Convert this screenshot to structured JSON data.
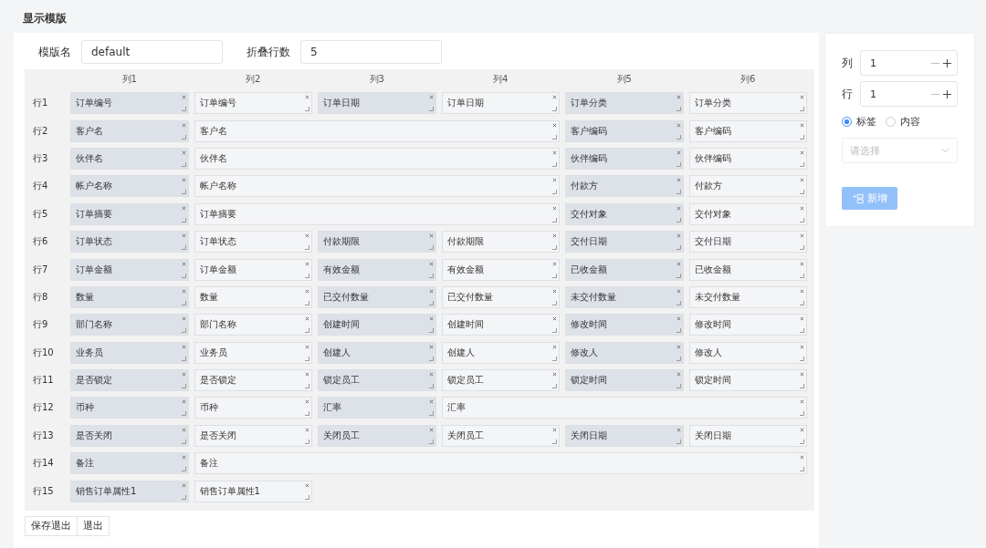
{
  "title": "显示模版",
  "form": {
    "template_name_label": "模版名",
    "template_name": "default",
    "fold_rows_label": "折叠行数",
    "fold_rows": "5"
  },
  "columns": [
    "列1",
    "列2",
    "列3",
    "列4",
    "列5",
    "列6"
  ],
  "rows": [
    {
      "label": "行1",
      "cells": [
        {
          "text": "订单编号",
          "kind": "label"
        },
        {
          "text": "订单编号",
          "kind": "content"
        },
        {
          "text": "订单日期",
          "kind": "label"
        },
        {
          "text": "订单日期",
          "kind": "content"
        },
        {
          "text": "订单分类",
          "kind": "label"
        },
        {
          "text": "订单分类",
          "kind": "content"
        }
      ]
    },
    {
      "label": "行2",
      "cells": [
        {
          "text": "客户名",
          "kind": "label"
        },
        {
          "text": "客户名",
          "kind": "content"
        },
        {
          "text": "客户编码",
          "kind": "label"
        },
        {
          "text": "客户编码",
          "kind": "content"
        }
      ]
    },
    {
      "label": "行3",
      "cells": [
        {
          "text": "伙伴名",
          "kind": "label"
        },
        {
          "text": "伙伴名",
          "kind": "content"
        },
        {
          "text": "伙伴编码",
          "kind": "label"
        },
        {
          "text": "伙伴编码",
          "kind": "content"
        }
      ]
    },
    {
      "label": "行4",
      "cells": [
        {
          "text": "帐户名称",
          "kind": "label"
        },
        {
          "text": "帐户名称",
          "kind": "content"
        },
        {
          "text": "付款方",
          "kind": "label"
        },
        {
          "text": "付款方",
          "kind": "content"
        }
      ]
    },
    {
      "label": "行5",
      "cells": [
        {
          "text": "订单摘要",
          "kind": "label"
        },
        {
          "text": "订单摘要",
          "kind": "content"
        },
        {
          "text": "交付对象",
          "kind": "label"
        },
        {
          "text": "交付对象",
          "kind": "content"
        }
      ]
    },
    {
      "label": "行6",
      "cells": [
        {
          "text": "订单状态",
          "kind": "label"
        },
        {
          "text": "订单状态",
          "kind": "content"
        },
        {
          "text": "付款期限",
          "kind": "label"
        },
        {
          "text": "付款期限",
          "kind": "content"
        },
        {
          "text": "交付日期",
          "kind": "label"
        },
        {
          "text": "交付日期",
          "kind": "content"
        }
      ]
    },
    {
      "label": "行7",
      "cells": [
        {
          "text": "订单金额",
          "kind": "label"
        },
        {
          "text": "订单金额",
          "kind": "content"
        },
        {
          "text": "有效金额",
          "kind": "label"
        },
        {
          "text": "有效金额",
          "kind": "content"
        },
        {
          "text": "已收金额",
          "kind": "label"
        },
        {
          "text": "已收金额",
          "kind": "content"
        }
      ]
    },
    {
      "label": "行8",
      "cells": [
        {
          "text": "数量",
          "kind": "label"
        },
        {
          "text": "数量",
          "kind": "content"
        },
        {
          "text": "已交付数量",
          "kind": "label"
        },
        {
          "text": "已交付数量",
          "kind": "content"
        },
        {
          "text": "未交付数量",
          "kind": "label"
        },
        {
          "text": "未交付数量",
          "kind": "content"
        }
      ]
    },
    {
      "label": "行9",
      "cells": [
        {
          "text": "部门名称",
          "kind": "label"
        },
        {
          "text": "部门名称",
          "kind": "content"
        },
        {
          "text": "创建时间",
          "kind": "label"
        },
        {
          "text": "创建时间",
          "kind": "content"
        },
        {
          "text": "修改时间",
          "kind": "label"
        },
        {
          "text": "修改时间",
          "kind": "content"
        }
      ]
    },
    {
      "label": "行10",
      "cells": [
        {
          "text": "业务员",
          "kind": "label"
        },
        {
          "text": "业务员",
          "kind": "content"
        },
        {
          "text": "创建人",
          "kind": "label"
        },
        {
          "text": "创建人",
          "kind": "content"
        },
        {
          "text": "修改人",
          "kind": "label"
        },
        {
          "text": "修改人",
          "kind": "content"
        }
      ]
    },
    {
      "label": "行11",
      "cells": [
        {
          "text": "是否锁定",
          "kind": "label"
        },
        {
          "text": "是否锁定",
          "kind": "content"
        },
        {
          "text": "锁定员工",
          "kind": "label"
        },
        {
          "text": "锁定员工",
          "kind": "content"
        },
        {
          "text": "锁定时间",
          "kind": "label"
        },
        {
          "text": "锁定时间",
          "kind": "content"
        }
      ]
    },
    {
      "label": "行12",
      "cells": [
        {
          "text": "币种",
          "kind": "label"
        },
        {
          "text": "币种",
          "kind": "content"
        },
        {
          "text": "汇率",
          "kind": "label"
        },
        {
          "text": "汇率",
          "kind": "content"
        }
      ]
    },
    {
      "label": "行13",
      "cells": [
        {
          "text": "是否关闭",
          "kind": "label"
        },
        {
          "text": "是否关闭",
          "kind": "content"
        },
        {
          "text": "关闭员工",
          "kind": "label"
        },
        {
          "text": "关闭员工",
          "kind": "content"
        },
        {
          "text": "关闭日期",
          "kind": "label"
        },
        {
          "text": "关闭日期",
          "kind": "content"
        }
      ]
    },
    {
      "label": "行14",
      "cells": [
        {
          "text": "备注",
          "kind": "label"
        },
        {
          "text": "备注",
          "kind": "content"
        }
      ]
    },
    {
      "label": "行15",
      "cells": [
        {
          "text": "销售订单属性1",
          "kind": "label"
        },
        {
          "text": "销售订单属性1",
          "kind": "content"
        }
      ]
    }
  ],
  "actions": [
    "保存退出",
    "退出"
  ],
  "side": {
    "column_label": "列",
    "column_value": "1",
    "row_label": "行",
    "row_value": "1",
    "radios": [
      {
        "label": "标签",
        "selected": true
      },
      {
        "label": "内容",
        "selected": false
      }
    ],
    "select_placeholder": "请选择",
    "add_button": "新增",
    "add_disabled": true
  }
}
